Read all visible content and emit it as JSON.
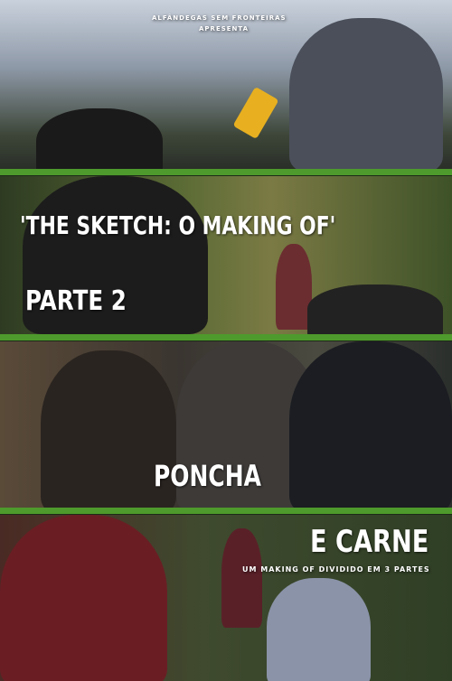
{
  "poster": {
    "presenter": "ALFÂNDEGAS SEM FRONTEIRAS",
    "presents": "APRESENTA",
    "title": "'THE SKETCH: O MAKING OF'",
    "part": "PARTE 2",
    "subtitle_line1": "PONCHA",
    "subtitle_line2": "E CARNE",
    "tagline": "UM MAKING OF DIVIDIDO EM 3 PARTES"
  },
  "colors": {
    "divider": "#4e9a2c",
    "text": "#ffffff"
  }
}
